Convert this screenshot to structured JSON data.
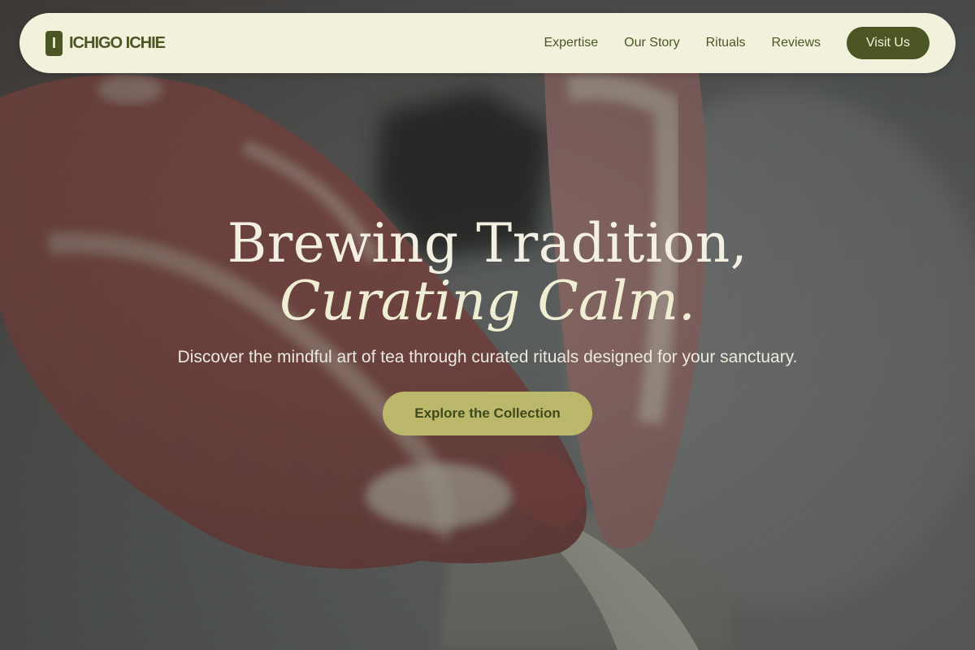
{
  "brand": {
    "mark": "I",
    "name": "ICHIGO ICHIE"
  },
  "nav": {
    "links": [
      "Expertise",
      "Our Story",
      "Rituals",
      "Reviews"
    ],
    "cta_label": "Visit Us"
  },
  "hero": {
    "title_line1": "Brewing Tradition,",
    "title_line2": "Curating Calm.",
    "subtitle": "Discover the mindful art of tea through curated rituals designed for your sanctuary.",
    "cta_label": "Explore the Collection",
    "background_image": "hands-shaping-clay-on-pottery-wheel"
  },
  "colors": {
    "nav_background": "#f2f1dc",
    "brand_green": "#4c5624",
    "cta_gold": "#bcb86b"
  }
}
